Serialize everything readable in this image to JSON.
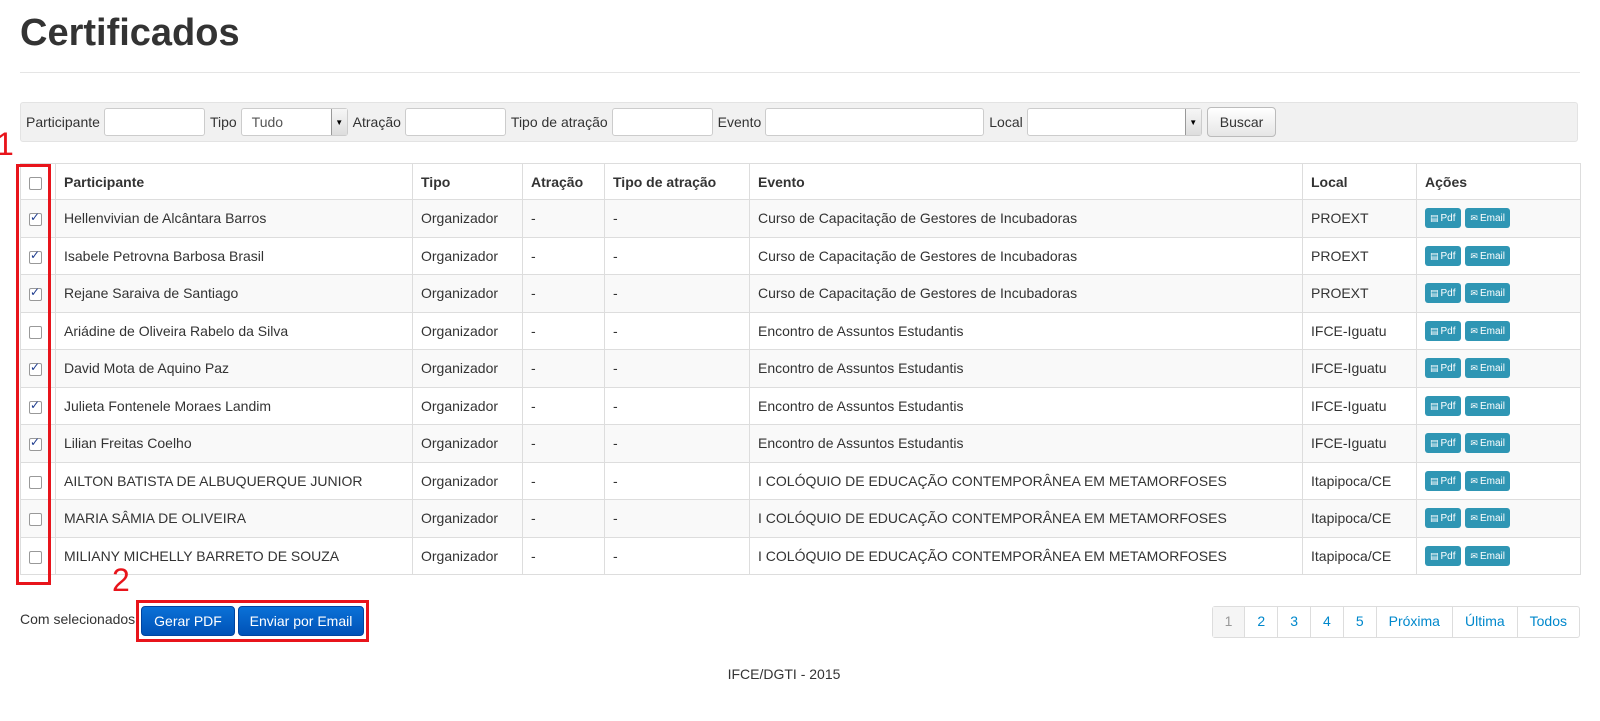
{
  "page": {
    "title": "Certificados"
  },
  "filter": {
    "participante_label": "Participante",
    "tipo_label": "Tipo",
    "tipo_value": "Tudo",
    "atracao_label": "Atração",
    "tipo_atracao_label": "Tipo de atração",
    "evento_label": "Evento",
    "local_label": "Local",
    "local_value": "",
    "buscar_label": "Buscar"
  },
  "table": {
    "headers": [
      "Participante",
      "Tipo",
      "Atração",
      "Tipo de atração",
      "Evento",
      "Local",
      "Ações"
    ],
    "select_all_checked": false,
    "rows": [
      {
        "checked": true,
        "participante": "Hellenvivian de Alcântara Barros",
        "tipo": "Organizador",
        "atracao": "-",
        "tipo_atracao": "-",
        "evento": "Curso de Capacitação de Gestores de Incubadoras",
        "local": "PROEXT"
      },
      {
        "checked": true,
        "participante": "Isabele Petrovna Barbosa Brasil",
        "tipo": "Organizador",
        "atracao": "-",
        "tipo_atracao": "-",
        "evento": "Curso de Capacitação de Gestores de Incubadoras",
        "local": "PROEXT"
      },
      {
        "checked": true,
        "participante": "Rejane Saraiva de Santiago",
        "tipo": "Organizador",
        "atracao": "-",
        "tipo_atracao": "-",
        "evento": "Curso de Capacitação de Gestores de Incubadoras",
        "local": "PROEXT"
      },
      {
        "checked": false,
        "participante": "Ariádine de Oliveira Rabelo da Silva",
        "tipo": "Organizador",
        "atracao": "-",
        "tipo_atracao": "-",
        "evento": "Encontro de Assuntos Estudantis",
        "local": "IFCE-Iguatu"
      },
      {
        "checked": true,
        "participante": "David Mota de Aquino Paz",
        "tipo": "Organizador",
        "atracao": "-",
        "tipo_atracao": "-",
        "evento": "Encontro de Assuntos Estudantis",
        "local": "IFCE-Iguatu"
      },
      {
        "checked": true,
        "participante": "Julieta Fontenele Moraes Landim",
        "tipo": "Organizador",
        "atracao": "-",
        "tipo_atracao": "-",
        "evento": "Encontro de Assuntos Estudantis",
        "local": "IFCE-Iguatu"
      },
      {
        "checked": true,
        "participante": "Lilian Freitas Coelho",
        "tipo": "Organizador",
        "atracao": "-",
        "tipo_atracao": "-",
        "evento": "Encontro de Assuntos Estudantis",
        "local": "IFCE-Iguatu"
      },
      {
        "checked": false,
        "participante": "AILTON BATISTA DE ALBUQUERQUE JUNIOR",
        "tipo": "Organizador",
        "atracao": "-",
        "tipo_atracao": "-",
        "evento": "I COLÓQUIO DE EDUCAÇÃO CONTEMPORÂNEA EM METAMORFOSES",
        "local": "Itapipoca/CE"
      },
      {
        "checked": false,
        "participante": "MARIA SÂMIA DE OLIVEIRA",
        "tipo": "Organizador",
        "atracao": "-",
        "tipo_atracao": "-",
        "evento": "I COLÓQUIO DE EDUCAÇÃO CONTEMPORÂNEA EM METAMORFOSES",
        "local": "Itapipoca/CE"
      },
      {
        "checked": false,
        "participante": "MILIANY MICHELLY BARRETO DE SOUZA",
        "tipo": "Organizador",
        "atracao": "-",
        "tipo_atracao": "-",
        "evento": "I COLÓQUIO DE EDUCAÇÃO CONTEMPORÂNEA EM METAMORFOSES",
        "local": "Itapipoca/CE"
      }
    ],
    "actions": {
      "pdf_label": "Pdf",
      "email_label": "Email",
      "pdf_icon": "file-icon",
      "email_icon": "envelope-icon"
    }
  },
  "bulk": {
    "label": "Com selecionados:",
    "gerar_pdf": "Gerar PDF",
    "enviar_email": "Enviar por Email"
  },
  "pagination": [
    "1",
    "2",
    "3",
    "4",
    "5",
    "Próxima",
    "Última",
    "Todos"
  ],
  "annotations": [
    "1",
    "2"
  ],
  "footer": "IFCE/DGTI - 2015",
  "colors": {
    "annotation": "#e8141b",
    "primary_button": "#0a6bd0",
    "action_button": "#2f96b4",
    "link": "#0088cc"
  }
}
